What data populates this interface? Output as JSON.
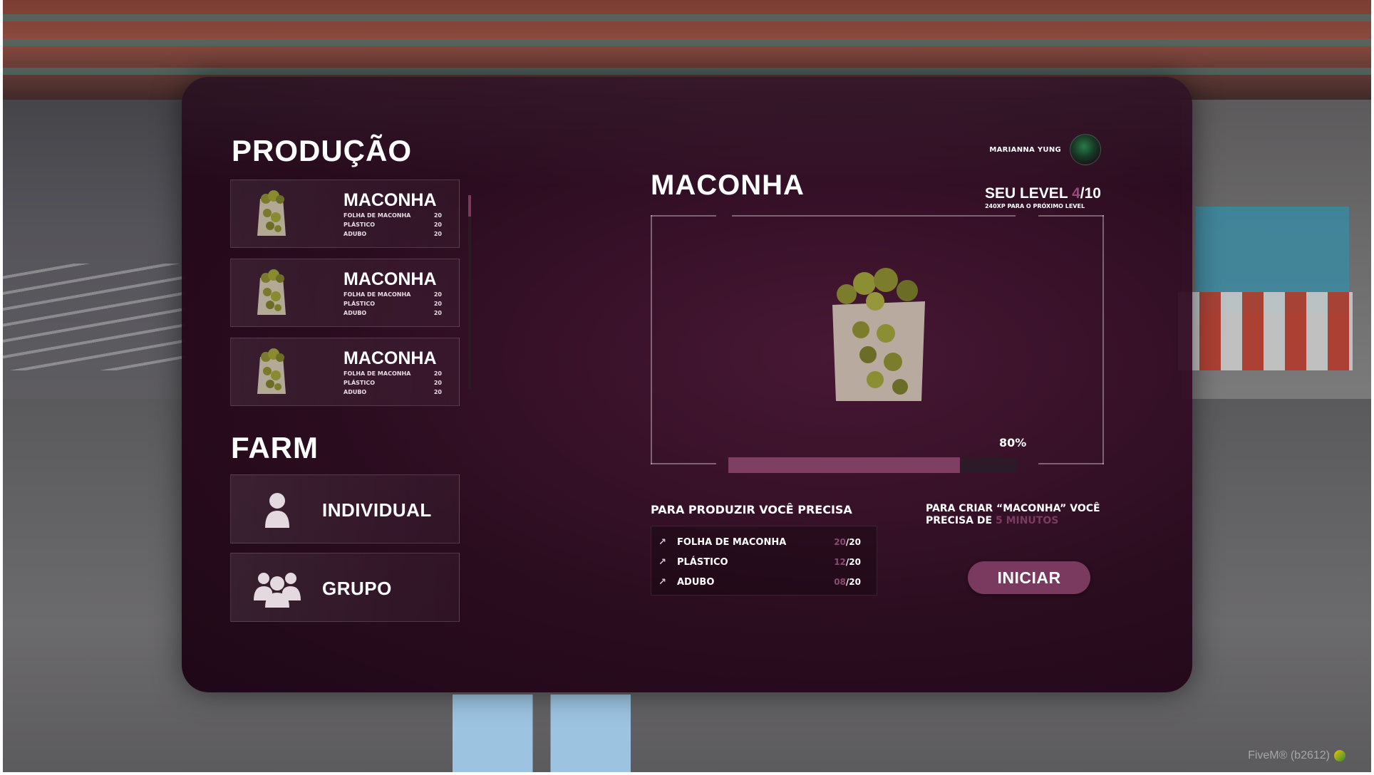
{
  "panel": {
    "production_title": "PRODUÇÃO",
    "farm_title": "FARM"
  },
  "production_items": [
    {
      "name": "MACONHA",
      "reqs": [
        {
          "label": "FOLHA DE MACONHA",
          "qty": "20"
        },
        {
          "label": "PLÁSTICO",
          "qty": "20"
        },
        {
          "label": "ADUBO",
          "qty": "20"
        }
      ]
    },
    {
      "name": "MACONHA",
      "reqs": [
        {
          "label": "FOLHA DE MACONHA",
          "qty": "20"
        },
        {
          "label": "PLÁSTICO",
          "qty": "20"
        },
        {
          "label": "ADUBO",
          "qty": "20"
        }
      ]
    },
    {
      "name": "MACONHA",
      "reqs": [
        {
          "label": "FOLHA DE MACONHA",
          "qty": "20"
        },
        {
          "label": "PLÁSTICO",
          "qty": "20"
        },
        {
          "label": "ADUBO",
          "qty": "20"
        }
      ]
    }
  ],
  "farm": {
    "individual_label": "INDIVIDUAL",
    "group_label": "GRUPO",
    "individual_icon": "person-icon",
    "group_icon": "group-icon"
  },
  "user": {
    "name": "MARIANNA YUNG"
  },
  "selected": {
    "title": "MACONHA",
    "level_prefix": "SEU LEVEL ",
    "level_current": "4",
    "level_max": "/10",
    "level_sub": "240XP PARA O PRÓXIMO LEVEL",
    "progress_label": "80%",
    "progress_value": 0.8
  },
  "requirements": {
    "title": "PARA PRODUZIR VOCÊ PRECISA",
    "items": [
      {
        "name": "FOLHA DE MACONHA",
        "have": "20",
        "need": "/20"
      },
      {
        "name": "PLÁSTICO",
        "have": "12",
        "need": "/20"
      },
      {
        "name": "ADUBO",
        "have": "08",
        "need": "/20"
      }
    ]
  },
  "time": {
    "text_a": "PARA CRIAR “MACONHA” VOCÊ PRECISA DE ",
    "text_b": "5 MINUTOS"
  },
  "actions": {
    "start_label": "INICIAR"
  },
  "watermark": {
    "text": "FiveM® (b2612)"
  },
  "colors": {
    "accent": "#7a3a5f",
    "panel": "#2a0a1e"
  }
}
